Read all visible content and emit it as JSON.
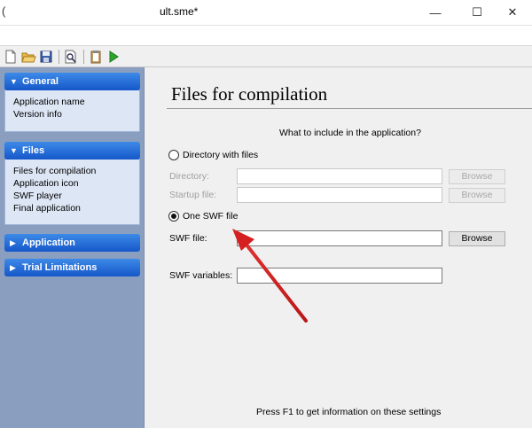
{
  "window": {
    "app_glyph": "(",
    "title": "ult.sme*",
    "minimize_symbol": "—",
    "maximize_symbol": "☐",
    "close_symbol": "✕"
  },
  "toolbar": {
    "buttons": [
      "new-file-icon",
      "open-folder-icon",
      "save-icon",
      "preview-icon",
      "clipboard-icon",
      "run-icon"
    ]
  },
  "sidebar": {
    "sections": [
      {
        "label": "General",
        "expanded": true,
        "items": [
          "Application name",
          "Version info"
        ]
      },
      {
        "label": "Files",
        "expanded": true,
        "items": [
          "Files for compilation",
          "Application icon",
          "SWF player",
          "Final application"
        ]
      },
      {
        "label": "Application",
        "expanded": false,
        "items": []
      },
      {
        "label": "Trial Limitations",
        "expanded": false,
        "items": []
      }
    ]
  },
  "main": {
    "title": "Files for compilation",
    "question": "What to include in the application?",
    "option_directory": {
      "label": "Directory with files",
      "selected": false,
      "directory_label": "Directory:",
      "directory_value": "",
      "startup_label": "Startup file:",
      "startup_value": "",
      "browse_label": "Browse"
    },
    "option_swf": {
      "label": "One SWF file",
      "selected": true,
      "swf_file_label": "SWF file:",
      "swf_file_value": "",
      "browse_label": "Browse"
    },
    "swf_variables_label": "SWF variables:",
    "swf_variables_value": "",
    "footer_hint": "Press F1 to get information on these settings"
  },
  "colors": {
    "section_header": "#1f63d6",
    "sidebar_background": "#8a9fbf",
    "annotation_arrow": "#d42020"
  }
}
